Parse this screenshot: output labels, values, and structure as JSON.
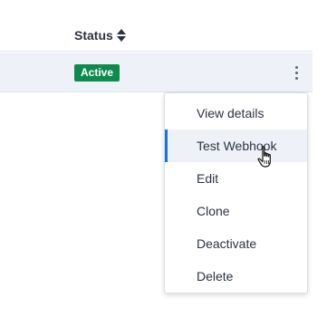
{
  "table": {
    "status_header": "Status",
    "sort_icon": "sort-up-down-icon"
  },
  "row": {
    "status": "Active",
    "status_color": "#0f8a4e",
    "actions_icon": "kebab-vertical-icon"
  },
  "menu": {
    "items": [
      {
        "label": "View details"
      },
      {
        "label": "Test Webhook",
        "hovered": true
      },
      {
        "label": "Edit"
      },
      {
        "label": "Clone"
      },
      {
        "label": "Deactivate"
      },
      {
        "label": "Delete"
      }
    ],
    "accent_color": "#1a73d9"
  },
  "cursor": {
    "icon": "hand-pointer-icon"
  }
}
